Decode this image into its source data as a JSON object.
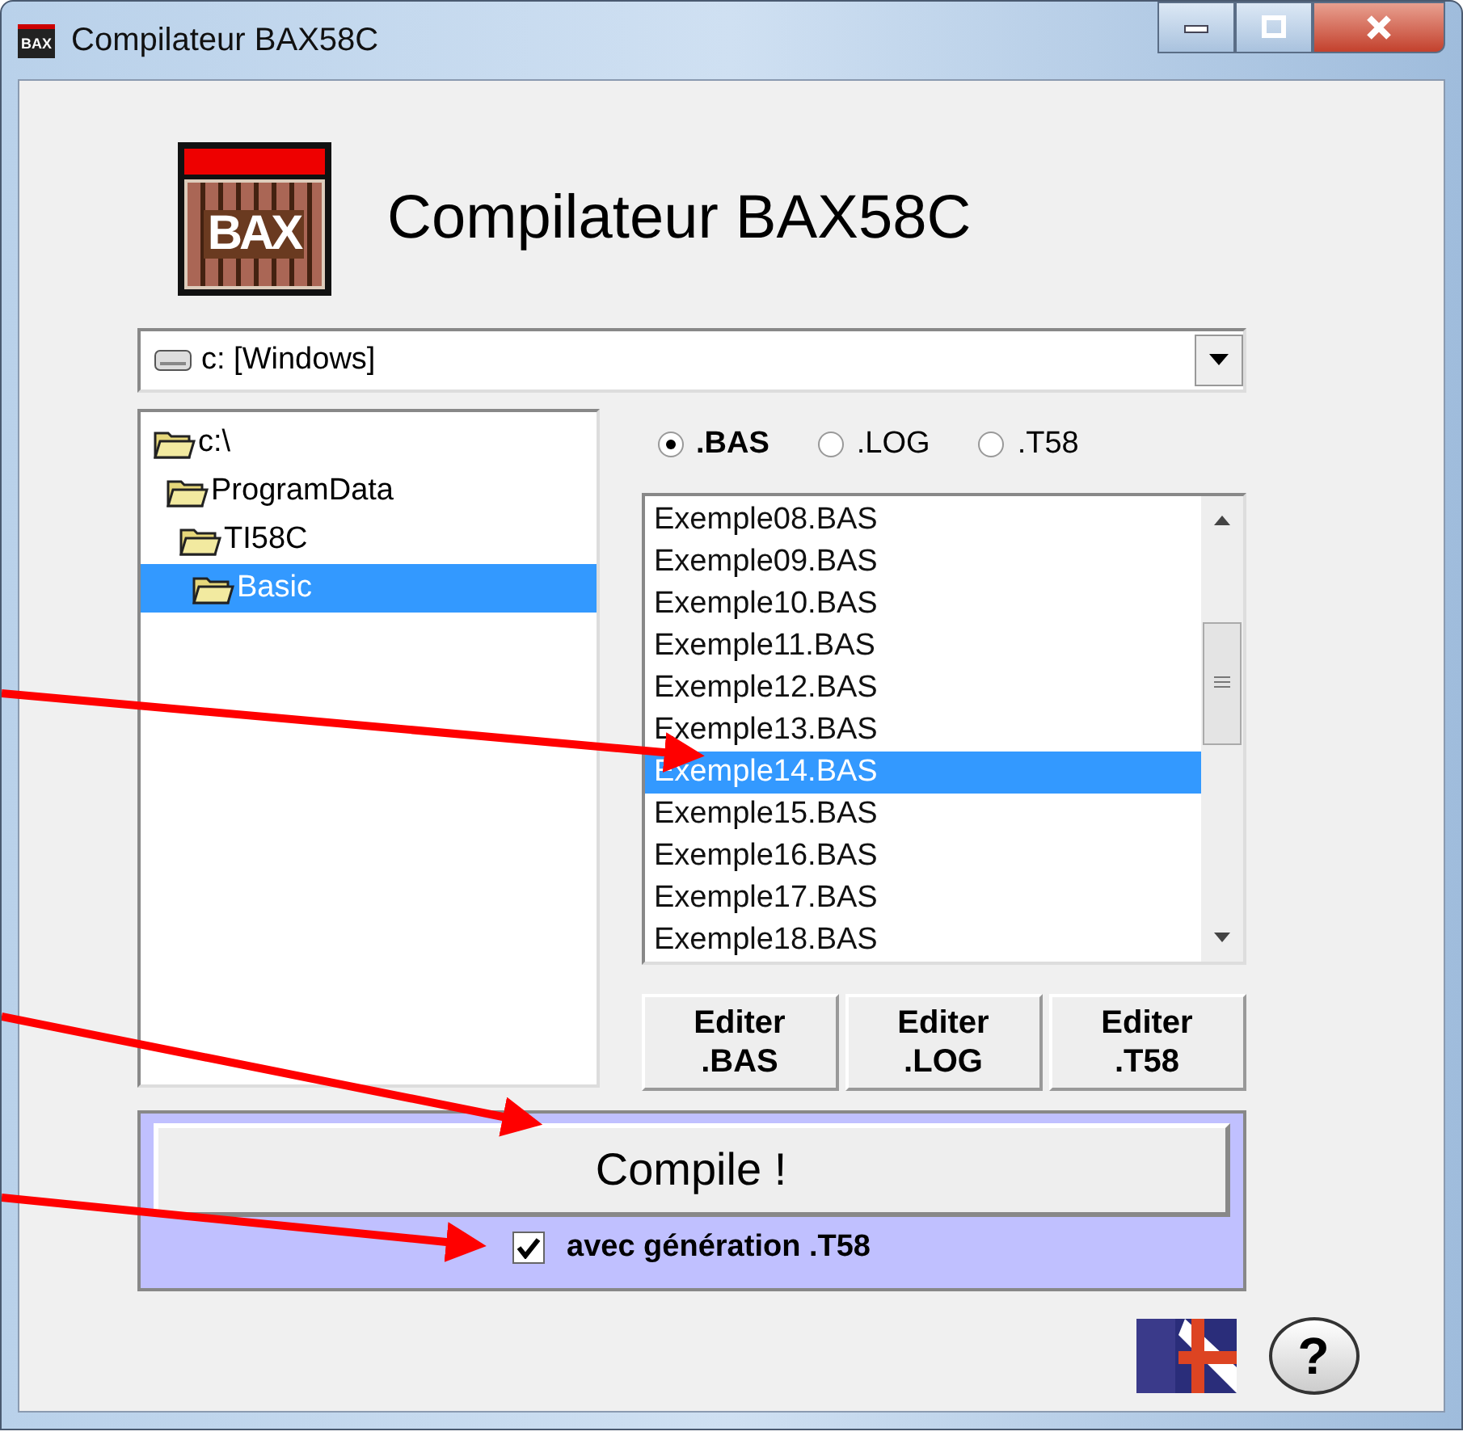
{
  "window": {
    "icon_text": "BAX",
    "title": "Compilateur BAX58C"
  },
  "header": {
    "logo": "BAX",
    "title": "Compilateur BAX58C"
  },
  "drive": {
    "value": "c: [Windows]"
  },
  "tree": [
    {
      "label": "c:\\",
      "selected": false,
      "children": [
        {
          "label": "ProgramData",
          "selected": false,
          "children": [
            {
              "label": "TI58C",
              "selected": false,
              "children": [
                {
                  "label": "Basic",
                  "selected": true
                }
              ]
            }
          ]
        }
      ]
    }
  ],
  "filters": [
    {
      "label": ".BAS",
      "selected": true
    },
    {
      "label": ".LOG",
      "selected": false
    },
    {
      "label": ".T58",
      "selected": false
    }
  ],
  "files": [
    {
      "name": "Exemple08.BAS",
      "selected": false
    },
    {
      "name": "Exemple09.BAS",
      "selected": false
    },
    {
      "name": "Exemple10.BAS",
      "selected": false
    },
    {
      "name": "Exemple11.BAS",
      "selected": false
    },
    {
      "name": "Exemple12.BAS",
      "selected": false
    },
    {
      "name": "Exemple13.BAS",
      "selected": false
    },
    {
      "name": "Exemple14.BAS",
      "selected": true
    },
    {
      "name": "Exemple15.BAS",
      "selected": false
    },
    {
      "name": "Exemple16.BAS",
      "selected": false
    },
    {
      "name": "Exemple17.BAS",
      "selected": false
    },
    {
      "name": "Exemple18.BAS",
      "selected": false
    }
  ],
  "edit_buttons": [
    {
      "lines": [
        "Editer",
        ".BAS"
      ]
    },
    {
      "lines": [
        "Editer",
        ".LOG"
      ]
    },
    {
      "lines": [
        "Editer",
        ".T58"
      ]
    }
  ],
  "compile": {
    "label": "Compile !",
    "option": {
      "label": "avec génération .T58",
      "checked": true
    }
  },
  "help": {
    "label": "?"
  }
}
